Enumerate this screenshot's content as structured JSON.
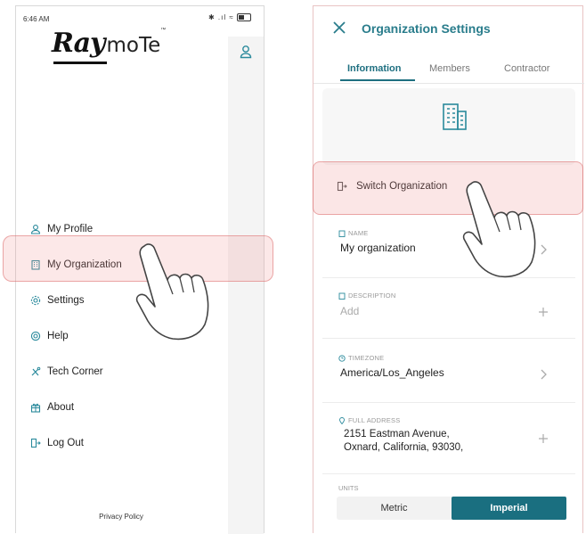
{
  "left": {
    "status_time": "6:46 AM",
    "status_signals": "✱ .ıl ≈",
    "battery_level": "56",
    "logo": {
      "bold": "Ray",
      "light": "moTe",
      "tm": "™"
    },
    "menu": [
      {
        "icon": "person-icon",
        "label": "My Profile"
      },
      {
        "icon": "building-icon",
        "label": "My Organization"
      },
      {
        "icon": "gear-icon",
        "label": "Settings"
      },
      {
        "icon": "lifebuoy-icon",
        "label": "Help"
      },
      {
        "icon": "tools-icon",
        "label": "Tech Corner"
      },
      {
        "icon": "gift-icon",
        "label": "About"
      },
      {
        "icon": "logout-icon",
        "label": "Log Out"
      }
    ],
    "privacy": "Privacy Policy"
  },
  "right": {
    "title": "Organization Settings",
    "tabs": [
      {
        "label": "Information",
        "active": true
      },
      {
        "label": "Members",
        "active": false
      },
      {
        "label": "Contractor",
        "active": false
      }
    ],
    "switch_org": "Switch Organization",
    "fields": {
      "name": {
        "label": "NAME",
        "value": "My organization"
      },
      "description": {
        "label": "DESCRIPTION",
        "placeholder": "Add"
      },
      "timezone": {
        "label": "TIMEZONE",
        "value": "America/Los_Angeles"
      },
      "address": {
        "label": "FULL ADDRESS",
        "line1": "2151 Eastman Avenue,",
        "line2": "Oxnard, California, 93030,"
      }
    },
    "units": {
      "label": "UNITS",
      "options": [
        "Metric",
        "Imperial"
      ],
      "selected": "Imperial"
    }
  },
  "colors": {
    "accent": "#1e6f80",
    "highlight": "#ee8c8c"
  }
}
